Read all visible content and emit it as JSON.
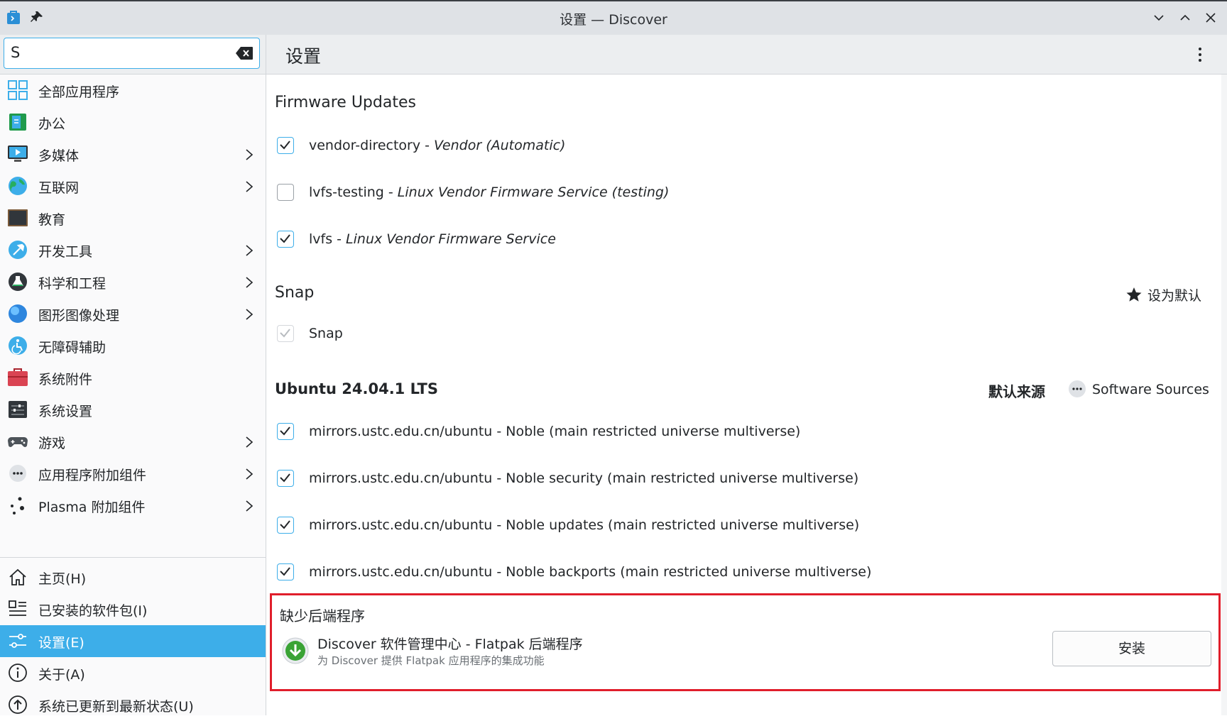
{
  "window": {
    "title": "设置 — Discover"
  },
  "search": {
    "value": "S"
  },
  "sidebar": {
    "categories": [
      {
        "label": "全部应用程序",
        "icon": "grid-icon",
        "chevron": false
      },
      {
        "label": "办公",
        "icon": "office-icon",
        "chevron": false
      },
      {
        "label": "多媒体",
        "icon": "multimedia-icon",
        "chevron": true
      },
      {
        "label": "互联网",
        "icon": "globe-icon",
        "chevron": true
      },
      {
        "label": "教育",
        "icon": "chalkboard-icon",
        "chevron": false
      },
      {
        "label": "开发工具",
        "icon": "hammer-icon",
        "chevron": true
      },
      {
        "label": "科学和工程",
        "icon": "flask-icon",
        "chevron": true
      },
      {
        "label": "图形图像处理",
        "icon": "graphics-icon",
        "chevron": true
      },
      {
        "label": "无障碍辅助",
        "icon": "accessibility-icon",
        "chevron": false
      },
      {
        "label": "系统附件",
        "icon": "toolbox-icon",
        "chevron": false
      },
      {
        "label": "系统设置",
        "icon": "system-settings-icon",
        "chevron": false
      },
      {
        "label": "游戏",
        "icon": "gamepad-icon",
        "chevron": true
      },
      {
        "label": "应用程序附加组件",
        "icon": "addons-icon",
        "chevron": true
      },
      {
        "label": "Plasma 附加组件",
        "icon": "plasma-icon",
        "chevron": true
      }
    ],
    "nav": [
      {
        "label": "主页(H)",
        "icon": "home-icon"
      },
      {
        "label": "已安装的软件包(I)",
        "icon": "installed-icon"
      },
      {
        "label": "设置(E)",
        "icon": "settings-sliders-icon",
        "active": true
      },
      {
        "label": "关于(A)",
        "icon": "info-icon"
      },
      {
        "label": "系统已更新到最新状态(U)",
        "icon": "update-icon"
      }
    ]
  },
  "main": {
    "title": "设置",
    "firmware": {
      "heading": "Firmware Updates",
      "items": [
        {
          "name": "vendor-directory - ",
          "desc": "Vendor (Automatic)",
          "checked": true
        },
        {
          "name": "lvfs-testing - ",
          "desc": "Linux Vendor Firmware Service (testing)",
          "checked": false
        },
        {
          "name": "lvfs - ",
          "desc": "Linux Vendor Firmware Service",
          "checked": true
        }
      ]
    },
    "snap": {
      "heading": "Snap",
      "make_default": "设为默认",
      "items": [
        {
          "name": "Snap",
          "checked": true,
          "disabled": true
        }
      ]
    },
    "ubuntu": {
      "heading": "Ubuntu 24.04.1 LTS",
      "default_source": "默认来源",
      "software_sources": "Software Sources",
      "items": [
        {
          "name": "mirrors.ustc.edu.cn/ubuntu - Noble (main restricted universe multiverse)",
          "checked": true
        },
        {
          "name": "mirrors.ustc.edu.cn/ubuntu - Noble security (main restricted universe multiverse)",
          "checked": true
        },
        {
          "name": "mirrors.ustc.edu.cn/ubuntu - Noble updates (main restricted universe multiverse)",
          "checked": true
        },
        {
          "name": "mirrors.ustc.edu.cn/ubuntu - Noble backports (main restricted universe multiverse)",
          "checked": true
        }
      ]
    },
    "missing_backend": {
      "heading": "缺少后端程序",
      "name": "Discover 软件管理中心 - Flatpak 后端程序",
      "description": "为 Discover 提供 Flatpak 应用程序的集成功能",
      "install_label": "安装"
    }
  },
  "colors": {
    "accent": "#3daee9",
    "highlight_border": "#e01e2b"
  }
}
